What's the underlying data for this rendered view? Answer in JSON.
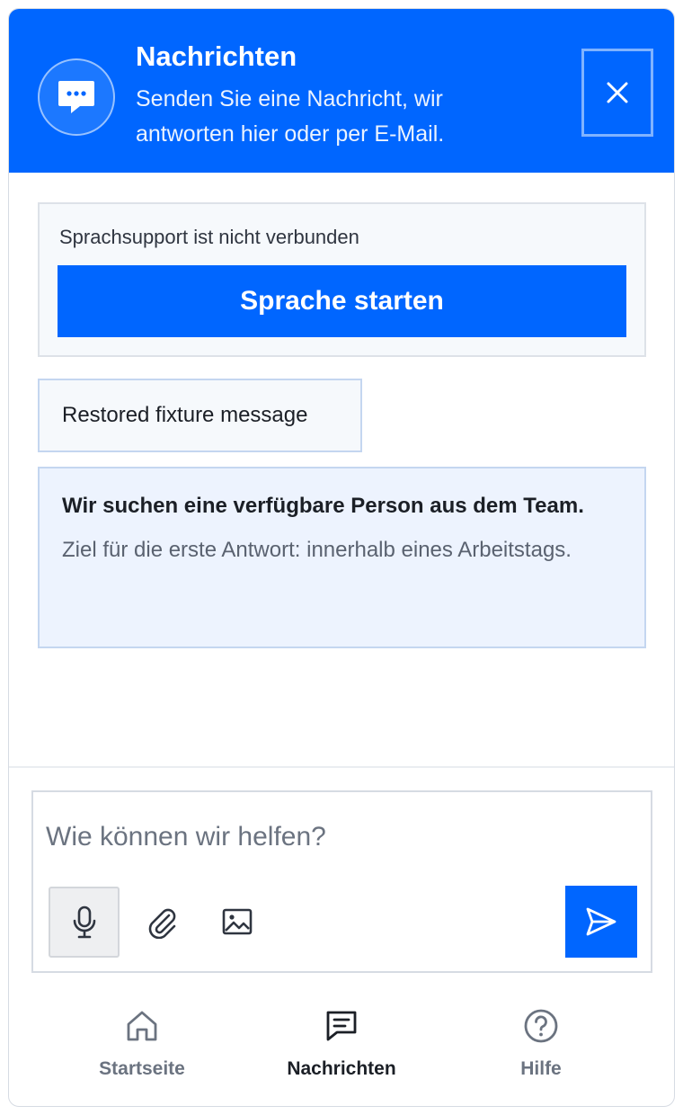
{
  "header": {
    "title": "Nachrichten",
    "subtitle": "Senden Sie eine Nachricht, wir antworten hier oder per E-Mail.",
    "avatar_icon": "chat-bubble-icon",
    "close_icon": "close-icon",
    "background_color": "#0066ff"
  },
  "voice": {
    "status": "Sprachsupport ist nicht verbunden",
    "start_label": "Sprache starten"
  },
  "messages": [
    {
      "text": "Restored fixture message"
    }
  ],
  "notice": {
    "title": "Wir suchen eine verfügbare Person aus dem Team.",
    "text": "Ziel für die erste Antwort: innerhalb eines Arbeitstags."
  },
  "composer": {
    "placeholder": "Wie können wir helfen?",
    "value": "",
    "tools": [
      "microphone-icon",
      "paperclip-icon",
      "image-icon"
    ],
    "send_icon": "send-icon"
  },
  "nav": {
    "items": [
      {
        "label": "Startseite",
        "icon": "home-icon",
        "active": false
      },
      {
        "label": "Nachrichten",
        "icon": "messages-icon",
        "active": true
      },
      {
        "label": "Hilfe",
        "icon": "help-icon",
        "active": false
      }
    ]
  },
  "colors": {
    "accent": "#0066ff",
    "text_primary": "#1b1f26",
    "text_muted": "#6b7380"
  }
}
